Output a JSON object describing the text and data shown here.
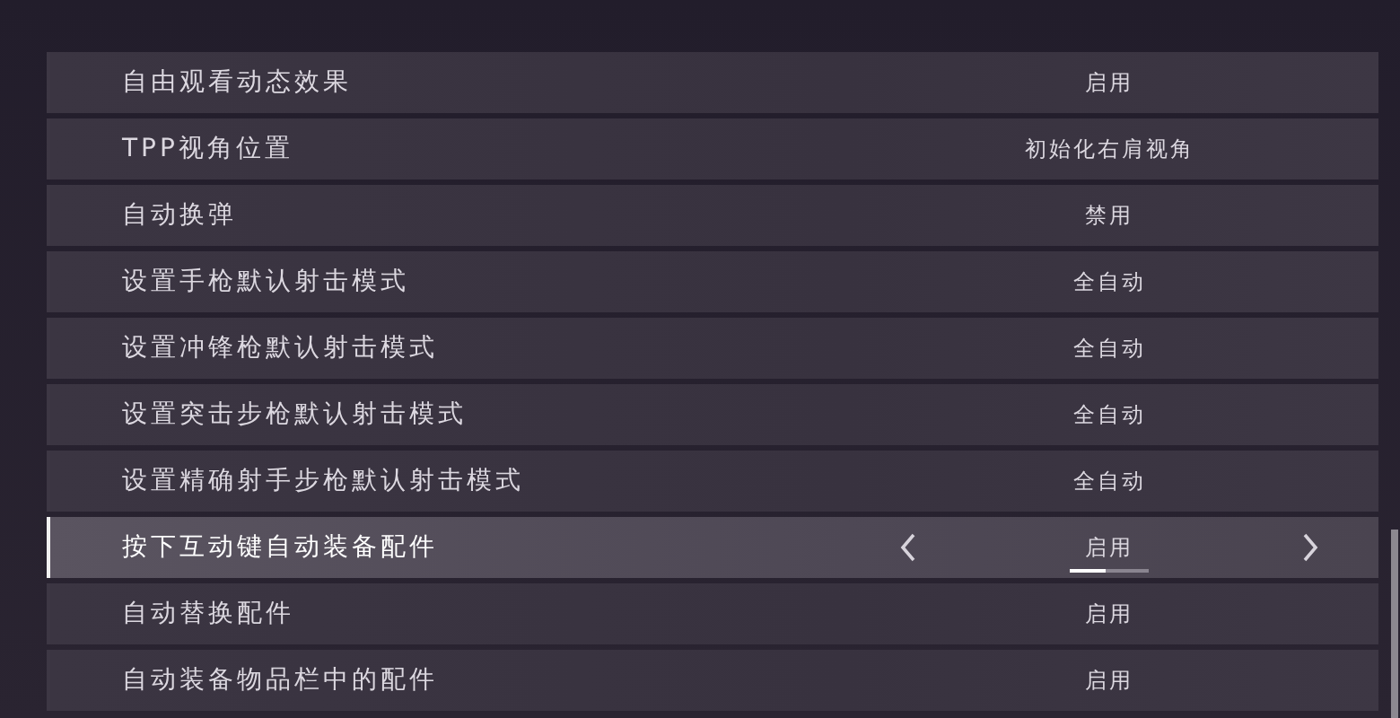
{
  "settings": [
    {
      "label": "自由观看动态效果",
      "value": "启用",
      "selected": false
    },
    {
      "label": "TPP视角位置",
      "value": "初始化右肩视角",
      "selected": false
    },
    {
      "label": "自动换弹",
      "value": "禁用",
      "selected": false
    },
    {
      "label": "设置手枪默认射击模式",
      "value": "全自动",
      "selected": false
    },
    {
      "label": "设置冲锋枪默认射击模式",
      "value": "全自动",
      "selected": false
    },
    {
      "label": "设置突击步枪默认射击模式",
      "value": "全自动",
      "selected": false
    },
    {
      "label": "设置精确射手步枪默认射击模式",
      "value": "全自动",
      "selected": false
    },
    {
      "label": "按下互动键自动装备配件",
      "value": "启用",
      "selected": true,
      "level": 0.45
    },
    {
      "label": "自动替换配件",
      "value": "启用",
      "selected": false
    },
    {
      "label": "自动装备物品栏中的配件",
      "value": "启用",
      "selected": false
    }
  ]
}
